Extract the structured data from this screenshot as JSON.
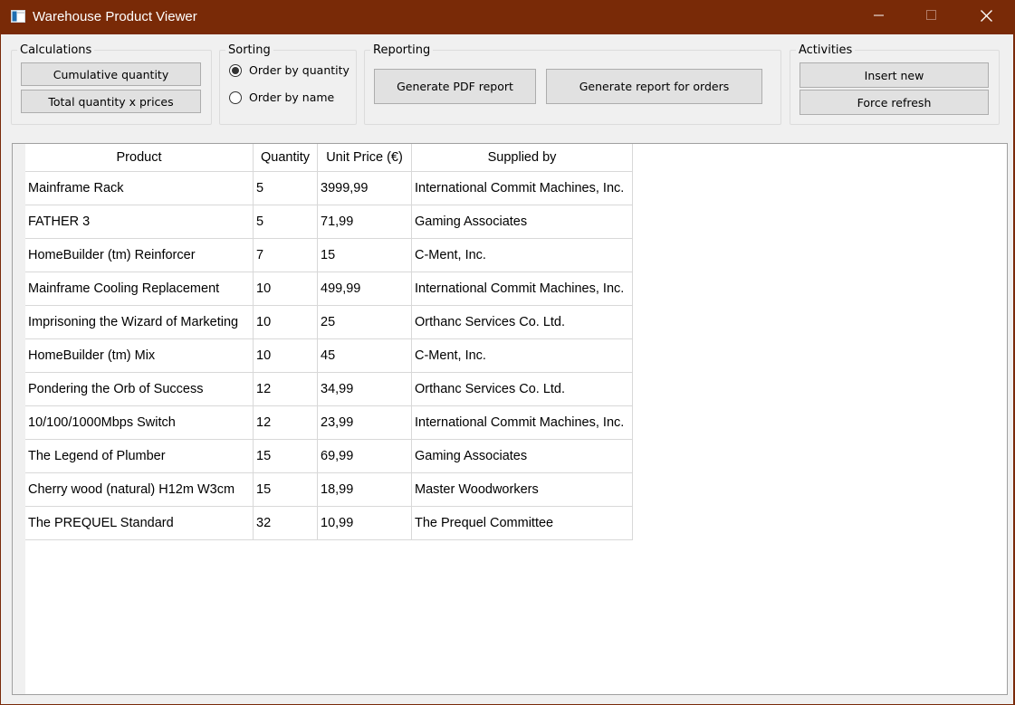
{
  "window": {
    "title": "Warehouse Product Viewer"
  },
  "groups": {
    "calculations": {
      "legend": "Calculations",
      "buttons": [
        "Cumulative quantity",
        "Total quantity x prices"
      ]
    },
    "sorting": {
      "legend": "Sorting",
      "options": [
        {
          "label": "Order by quantity",
          "checked": true
        },
        {
          "label": "Order by name",
          "checked": false
        }
      ]
    },
    "reporting": {
      "legend": "Reporting",
      "buttons": [
        "Generate PDF report",
        "Generate report for orders"
      ]
    },
    "activities": {
      "legend": "Activities",
      "buttons": [
        "Insert new",
        "Force refresh"
      ]
    }
  },
  "table": {
    "columns": [
      "Product",
      "Quantity",
      "Unit Price (€)",
      "Supplied by"
    ],
    "rows": [
      [
        "Mainframe Rack",
        "5",
        "3999,99",
        "International Commit Machines, Inc."
      ],
      [
        "FATHER 3",
        "5",
        "71,99",
        "Gaming Associates"
      ],
      [
        "HomeBuilder (tm) Reinforcer",
        "7",
        "15",
        "C-Ment, Inc."
      ],
      [
        "Mainframe Cooling Replacement",
        "10",
        "499,99",
        "International Commit Machines, Inc."
      ],
      [
        "Imprisoning the Wizard of Marketing",
        "10",
        "25",
        "Orthanc Services Co. Ltd."
      ],
      [
        "HomeBuilder (tm) Mix",
        "10",
        "45",
        "C-Ment, Inc."
      ],
      [
        "Pondering the Orb of Success",
        "12",
        "34,99",
        "Orthanc Services Co. Ltd."
      ],
      [
        "10/100/1000Mbps Switch",
        "12",
        "23,99",
        "International Commit Machines, Inc."
      ],
      [
        "The Legend of Plumber",
        "15",
        "69,99",
        "Gaming Associates"
      ],
      [
        "Cherry wood (natural) H12m W3cm",
        "15",
        "18,99",
        "Master Woodworkers"
      ],
      [
        "The PREQUEL Standard",
        "32",
        "10,99",
        "The Prequel Committee"
      ]
    ]
  },
  "icons": {
    "app": "app-window-icon",
    "minimize": "minimize-icon",
    "maximize": "maximize-icon",
    "close": "close-icon"
  },
  "colors": {
    "titlebar": "#792a07",
    "client": "#f0f0f0"
  }
}
